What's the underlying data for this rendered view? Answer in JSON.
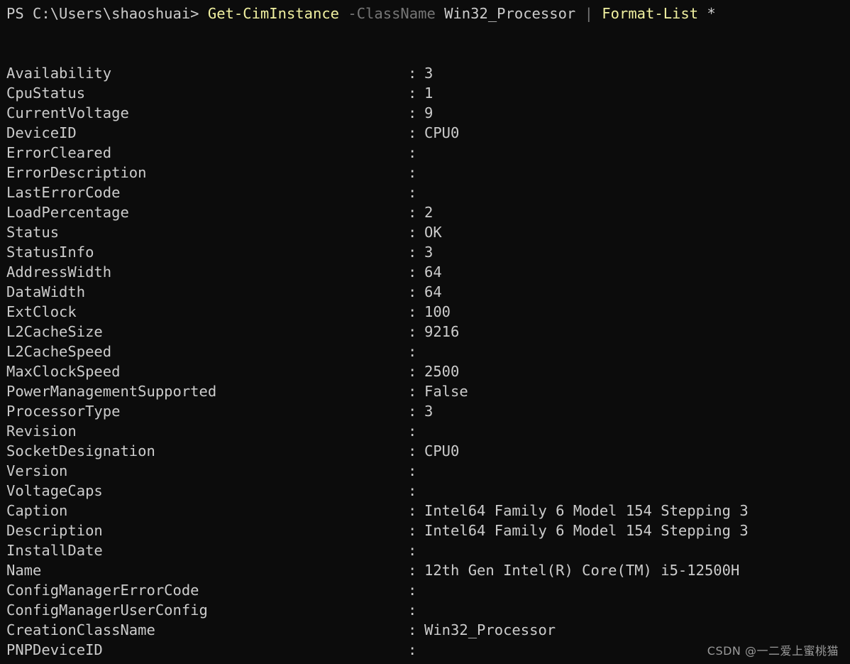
{
  "terminal": {
    "background_color": "#0c0c0c",
    "foreground_color": "#cccccc",
    "command_color": "#f0f0a0",
    "parameter_color": "#767676"
  },
  "prompt": {
    "prefix": "PS C:\\Users\\shaoshuai> ",
    "command": "Get-CimInstance",
    "space1": " ",
    "parameter": "-ClassName",
    "space2": " ",
    "argument": "Win32_Processor",
    "space3": " ",
    "pipe": "|",
    "space4": " ",
    "command2": "Format-List",
    "space5": " ",
    "argument2": "*"
  },
  "output": {
    "separator": ":",
    "properties": [
      {
        "name": "Availability",
        "value": "3"
      },
      {
        "name": "CpuStatus",
        "value": "1"
      },
      {
        "name": "CurrentVoltage",
        "value": "9"
      },
      {
        "name": "DeviceID",
        "value": "CPU0"
      },
      {
        "name": "ErrorCleared",
        "value": ""
      },
      {
        "name": "ErrorDescription",
        "value": ""
      },
      {
        "name": "LastErrorCode",
        "value": ""
      },
      {
        "name": "LoadPercentage",
        "value": "2"
      },
      {
        "name": "Status",
        "value": "OK"
      },
      {
        "name": "StatusInfo",
        "value": "3"
      },
      {
        "name": "AddressWidth",
        "value": "64"
      },
      {
        "name": "DataWidth",
        "value": "64"
      },
      {
        "name": "ExtClock",
        "value": "100"
      },
      {
        "name": "L2CacheSize",
        "value": "9216"
      },
      {
        "name": "L2CacheSpeed",
        "value": ""
      },
      {
        "name": "MaxClockSpeed",
        "value": "2500"
      },
      {
        "name": "PowerManagementSupported",
        "value": "False"
      },
      {
        "name": "ProcessorType",
        "value": "3"
      },
      {
        "name": "Revision",
        "value": ""
      },
      {
        "name": "SocketDesignation",
        "value": "CPU0"
      },
      {
        "name": "Version",
        "value": ""
      },
      {
        "name": "VoltageCaps",
        "value": ""
      },
      {
        "name": "Caption",
        "value": "Intel64 Family 6 Model 154 Stepping 3"
      },
      {
        "name": "Description",
        "value": "Intel64 Family 6 Model 154 Stepping 3"
      },
      {
        "name": "InstallDate",
        "value": ""
      },
      {
        "name": "Name",
        "value": "12th Gen Intel(R) Core(TM) i5-12500H"
      },
      {
        "name": "ConfigManagerErrorCode",
        "value": ""
      },
      {
        "name": "ConfigManagerUserConfig",
        "value": ""
      },
      {
        "name": "CreationClassName",
        "value": "Win32_Processor"
      },
      {
        "name": "PNPDeviceID",
        "value": ""
      }
    ]
  },
  "watermark": {
    "text": "CSDN @一二爱上蜜桃猫"
  }
}
